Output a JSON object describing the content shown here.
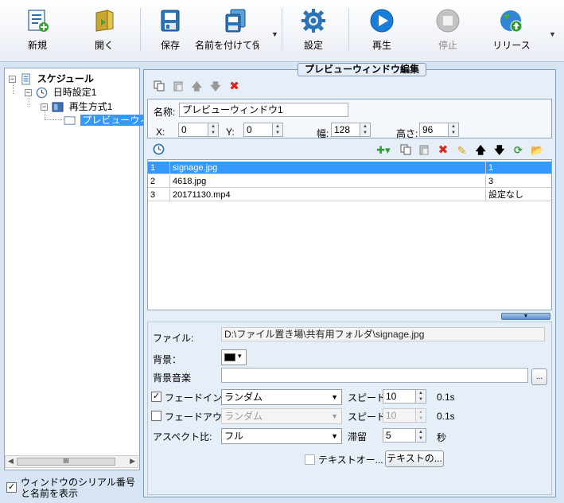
{
  "toolbar": {
    "buttons": [
      {
        "label": "新規",
        "icon": "new-schedule-icon",
        "enabled": true
      },
      {
        "label": "開く",
        "icon": "open-folder-icon",
        "enabled": true
      },
      {
        "label": "保存",
        "icon": "save-icon",
        "enabled": true
      },
      {
        "label": "名前を付けて保存",
        "icon": "save-as-icon",
        "enabled": true
      },
      {
        "label": "設定",
        "icon": "gear-icon",
        "enabled": true
      },
      {
        "label": "再生",
        "icon": "play-icon",
        "enabled": true
      },
      {
        "label": "停止",
        "icon": "stop-icon",
        "enabled": false
      },
      {
        "label": "リリース",
        "icon": "globe-release-icon",
        "enabled": true
      }
    ]
  },
  "tree": {
    "root": "スケジュール",
    "datetime": "日時設定1",
    "playback": "再生方式1",
    "window": "プレビューウィ",
    "scroll_thumb": "III"
  },
  "left_bottom": {
    "show_serial_checked": true,
    "show_serial_label": "ウィンドウのシリアル番号と名前を表示"
  },
  "editor": {
    "title": "プレビューウィンドウ編集",
    "name_label": "名称:",
    "name_value": "プレビューウィンドウ1",
    "x_label": "X:",
    "x_value": "0",
    "y_label": "Y:",
    "y_value": "0",
    "width_label": "幅:",
    "width_value": "128",
    "height_label": "高さ:",
    "height_value": "96"
  },
  "playlist": {
    "rows": [
      {
        "num": "1",
        "name": "signage.jpg",
        "duration": "1",
        "selected": true
      },
      {
        "num": "2",
        "name": "4618.jpg",
        "duration": "3",
        "selected": false
      },
      {
        "num": "3",
        "name": "20171130.mp4",
        "duration": "設定なし",
        "selected": false
      }
    ]
  },
  "properties": {
    "file_label": "ファイル:",
    "file_value": "D:\\ファイル置き場\\共有用フォルダ\\signage.jpg",
    "bg_label": "背景：",
    "bg_color": "#000000",
    "bgm_label": "背景音楽",
    "bgm_value": "",
    "browse_label": "...",
    "fadein_label": "フェードイン",
    "fadein_checked": true,
    "fadein_mode": "ランダム",
    "fadein_speed_label": "スピード:",
    "fadein_speed": "10",
    "fadein_unit": "0.1s",
    "fadeout_label": "フェードアウト",
    "fadeout_checked": false,
    "fadeout_mode": "ランダム",
    "fadeout_speed_label": "スピード:",
    "fadeout_speed": "10",
    "fadeout_unit": "0.1s",
    "aspect_label": "アスペクト比:",
    "aspect_value": "フル",
    "stay_label": "滞留",
    "stay_value": "5",
    "stay_unit": "秒",
    "text_check_label": "テキストオー...",
    "text_button_label": "テキストの..."
  },
  "colors": {
    "accent": "#3399ff",
    "panel_bg": "#e6eef8",
    "border": "#7f9db9",
    "delete_red": "#d9251c"
  }
}
